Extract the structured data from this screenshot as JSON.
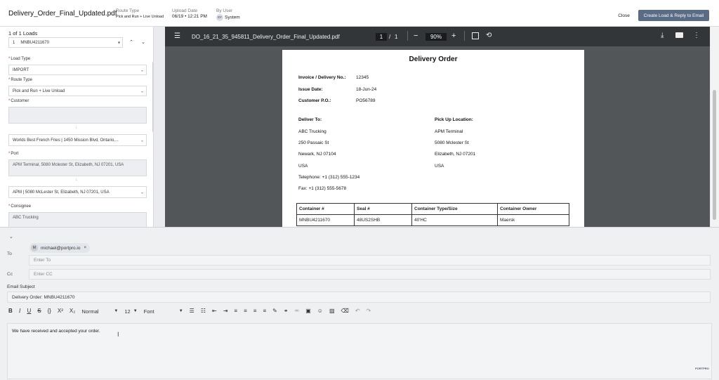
{
  "header": {
    "file_name": "Delivery_Order_Final_Updated.pdf",
    "route_type_label": "Route Type",
    "route_type_value": "Pick and Run + Live Unload",
    "upload_date_label": "Upload Date",
    "upload_date_value": "06/19 • 12:21 PM",
    "by_user_label": "By User",
    "by_user_initials": "SY",
    "by_user_value": "System",
    "close_label": "Close",
    "create_label": "Create Load & Reply to Email"
  },
  "left": {
    "loads_count": "1 of 1 Loads",
    "load_selector": {
      "index": "1",
      "value": "MNBU4211670"
    },
    "load_type_label": "Load Type",
    "load_type_value": "IMPORT",
    "route_type_label": "Route Type",
    "route_type_value": "Pick and Run + Live Unload",
    "customer_label": "Customer",
    "customer_value": "Worlds Best French Fries | 1450 Mission Blvd, Ontario,...",
    "port_label": "Port",
    "port_text": "APM Terminal, 5080 Mclester St, Elizabeth, NJ 07201, USA",
    "port_value": "APM | 5080 McLester St, Elizabeth, NJ 07201, USA",
    "consignee_label": "Consignee",
    "consignee_text": "ABC Trucking"
  },
  "pdf": {
    "file_name": "DO_16_21_35_945811_Delivery_Order_Final_Updated.pdf",
    "page_current": "1",
    "page_total": "1",
    "zoom": "90%",
    "doc": {
      "title": "Delivery Order",
      "invoice_label": "Invoice / Delivery No.:",
      "invoice_value": "12345",
      "issue_label": "Issue Date:",
      "issue_value": "18-Jun-24",
      "po_label": "Customer P.O.:",
      "po_value": "PO56789",
      "deliver_to_label": "Deliver To:",
      "deliver_to_lines": [
        "ABC Trucking",
        "250 Passaic St",
        "Newark, NJ 07104",
        "USA",
        "Telephone: +1 (312) 555-1234",
        "Fax: +1 (312) 555-5678"
      ],
      "pickup_label": "Pick Up Location:",
      "pickup_lines": [
        "APM Terminal",
        "5080 Mclester St",
        "Elizabeth, NJ 07201",
        "USA"
      ],
      "table_headers": [
        "Container #",
        "Seal #",
        "Container Type/Size",
        "Container Owner"
      ],
      "table_row": [
        "MNBU4211670",
        "48US2SHB",
        "40'HC",
        "Maersk"
      ]
    }
  },
  "email": {
    "to_label": "To",
    "to_chip_initial": "M",
    "to_chip": "michael@portpro.io",
    "to_placeholder": "Enter To",
    "cc_label": "Cc",
    "cc_placeholder": "Enter CC",
    "subject_label": "Email Subject",
    "subject_value": "Delivery Order: MNBU4211670",
    "format_value": "Normal",
    "font_size_value": "12",
    "font_value": "Font",
    "body_text": "We have received and accepted your order.",
    "brand": "PORTPRO"
  }
}
